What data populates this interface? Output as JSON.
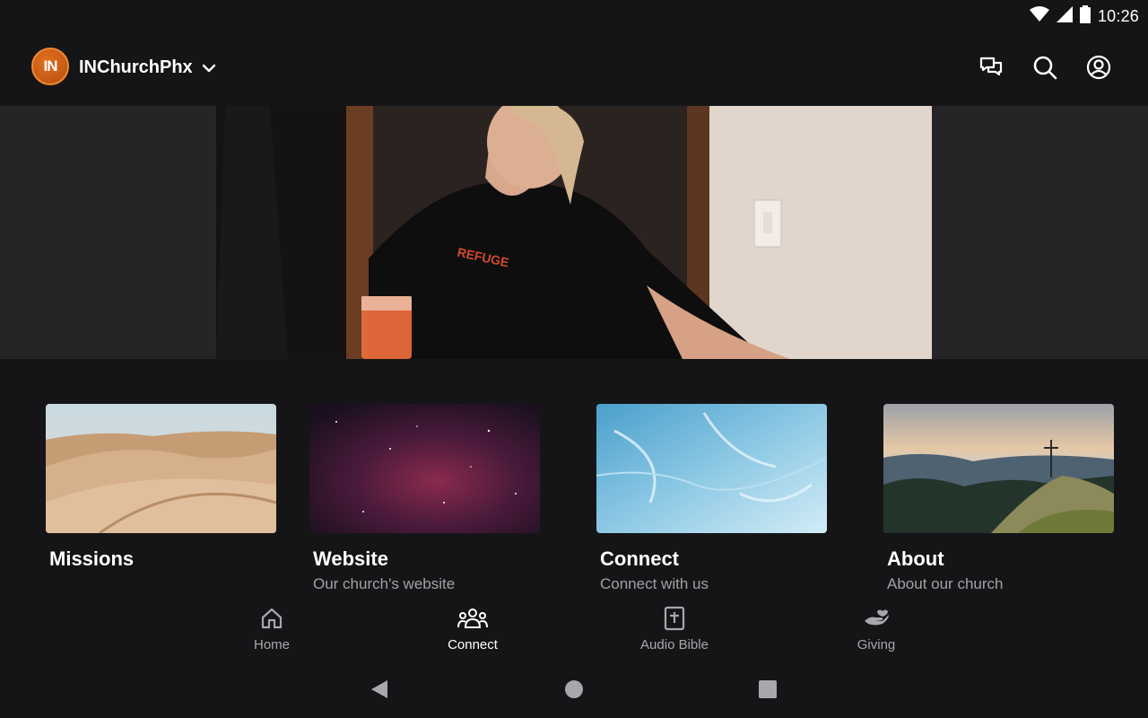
{
  "status_bar": {
    "time": "10:26"
  },
  "app_bar": {
    "logo_text": "IN",
    "church_name": "INChurchPhx"
  },
  "cards": [
    {
      "title": "Missions",
      "subtitle": ""
    },
    {
      "title": "Website",
      "subtitle": "Our church's website"
    },
    {
      "title": "Connect",
      "subtitle": "Connect with us"
    },
    {
      "title": "About",
      "subtitle": "About our church"
    }
  ],
  "bottom_nav": {
    "items": [
      {
        "label": "Home",
        "icon": "home-icon",
        "active": false
      },
      {
        "label": "Connect",
        "icon": "people-icon",
        "active": true
      },
      {
        "label": "Audio Bible",
        "icon": "bible-icon",
        "active": false
      },
      {
        "label": "Giving",
        "icon": "giving-hand-icon",
        "active": false
      }
    ]
  },
  "colors": {
    "background": "#151517",
    "hero_band": "#252527",
    "accent_logo": "#d2621a",
    "muted_text": "#a2a2a6"
  }
}
